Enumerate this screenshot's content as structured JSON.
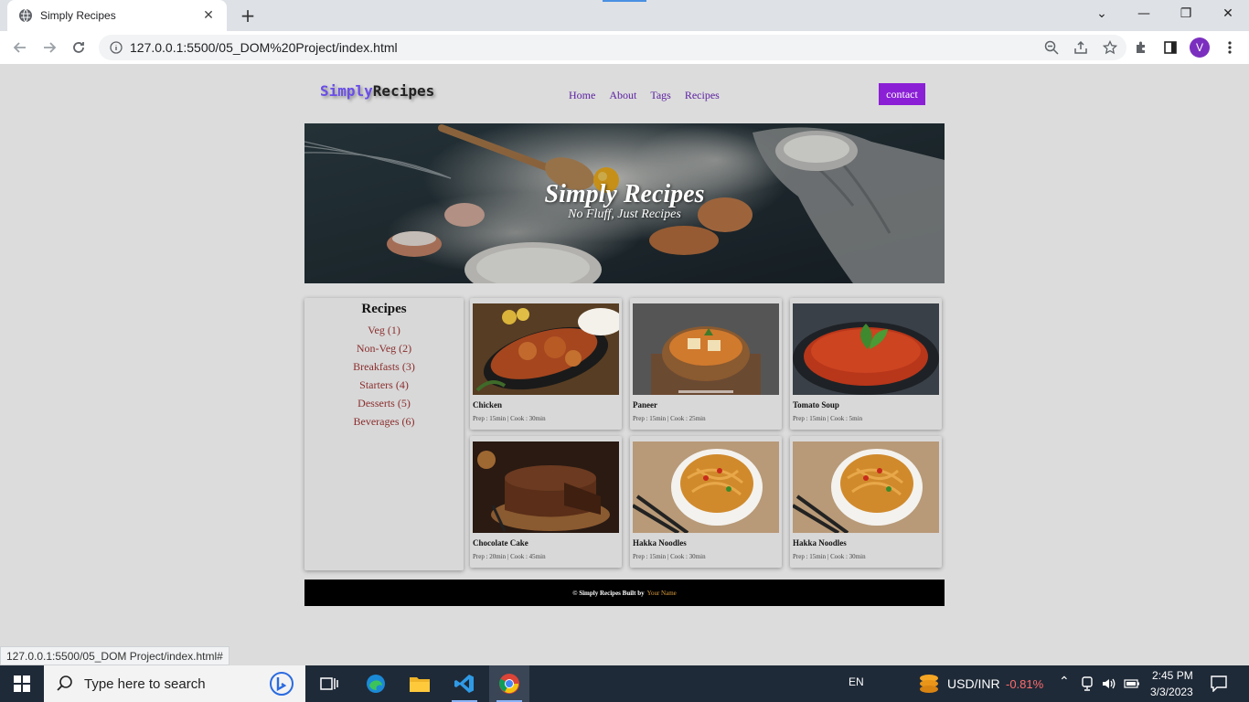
{
  "browser": {
    "tab_title": "Simply Recipes",
    "url": "127.0.0.1:5500/05_DOM%20Project/index.html",
    "profile_initial": "V",
    "status_url": "127.0.0.1:5500/05_DOM Project/index.html#"
  },
  "site": {
    "logo_part1": "Simply",
    "logo_part2": "Recipes",
    "nav": [
      "Home",
      "About",
      "Tags",
      "Recipes"
    ],
    "contact_label": "contact",
    "hero_title": "Simply Recipes",
    "hero_subtitle": "No Fluff, Just Recipes"
  },
  "sidebar": {
    "title": "Recipes",
    "categories": [
      "Veg (1)",
      "Non-Veg (2)",
      "Breakfasts (3)",
      "Starters (4)",
      "Desserts (5)",
      "Beverages (6)"
    ]
  },
  "recipes": [
    {
      "name": "Chicken",
      "meta": "Prep : 15min | Cook : 30min"
    },
    {
      "name": "Paneer",
      "meta": "Prep : 15min | Cook : 25min"
    },
    {
      "name": "Tomato Soup",
      "meta": "Prep : 15min | Cook : 5min"
    },
    {
      "name": "Chocolate Cake",
      "meta": "Prep : 20min | Cook : 45min"
    },
    {
      "name": "Hakka Noodles",
      "meta": "Prep : 15min | Cook : 30min"
    },
    {
      "name": "Hakka Noodles",
      "meta": "Prep : 15min | Cook : 30min"
    }
  ],
  "footer": {
    "text": "© Simply Recipes Built by",
    "author": "Your Name"
  },
  "taskbar": {
    "search_placeholder": "Type here to search",
    "lang": "EN",
    "ticker": "USD/INR",
    "ticker_change": "-0.81%",
    "time": "2:45 PM",
    "date": "3/3/2023"
  },
  "colors": {
    "accent": "#8b1fd6",
    "nav_link": "#5a1fa0",
    "category_link": "#8b2d2d",
    "footer_author": "#e0a040",
    "ticker_negative": "#ff6b6b"
  }
}
